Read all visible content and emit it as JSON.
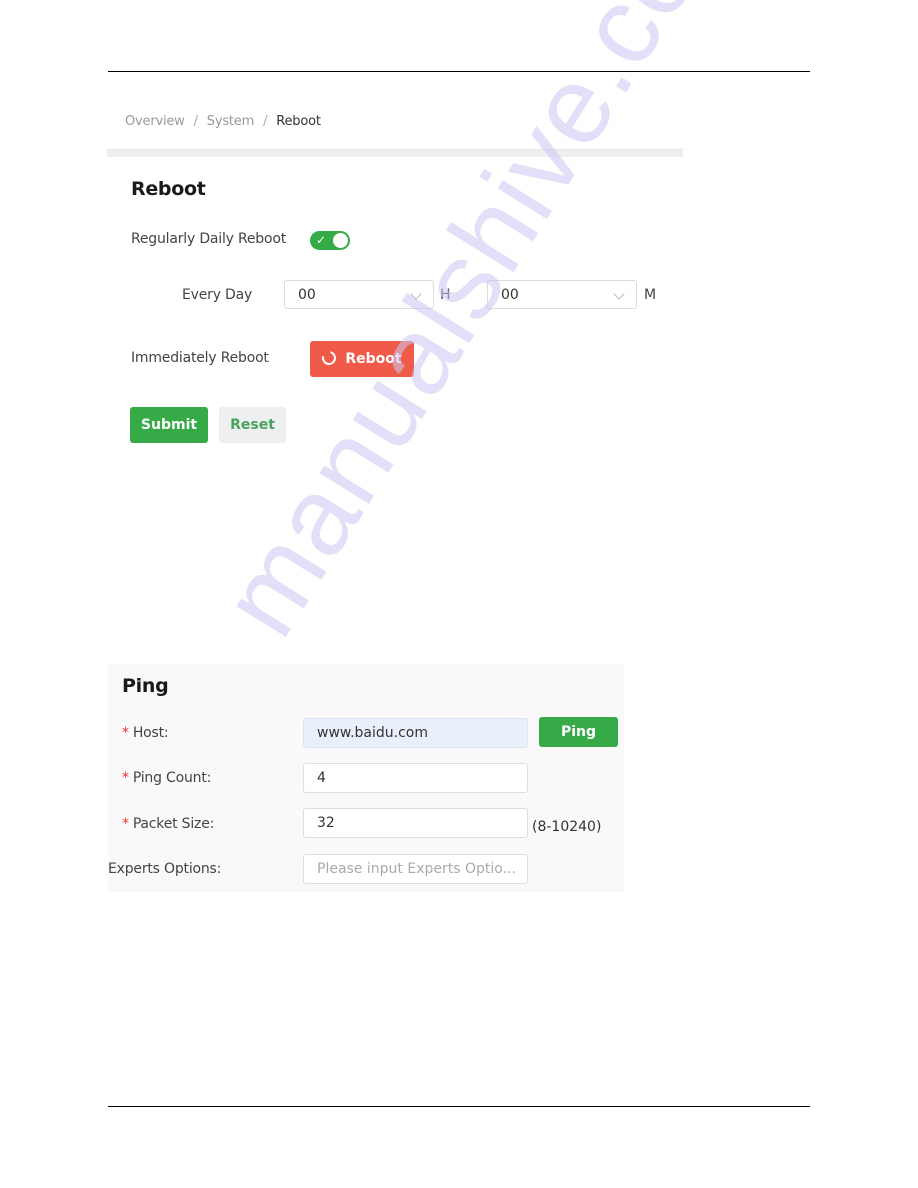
{
  "watermark": "manualshive.com",
  "breadcrumb": {
    "items": [
      "Overview",
      "System",
      "Reboot"
    ],
    "separator": "/"
  },
  "reboot": {
    "title": "Reboot",
    "daily_reboot": {
      "label": "Regularly Daily Reboot",
      "enabled": true,
      "check_glyph": "✓"
    },
    "schedule": {
      "label": "Every Day",
      "hour_value": "00",
      "hour_unit": "H",
      "minute_value": "00",
      "minute_unit": "M"
    },
    "immediate": {
      "label": "Immediately Reboot",
      "button_label": "Reboot",
      "button_icon": "refresh-icon"
    },
    "submit_label": "Submit",
    "reset_label": "Reset"
  },
  "ping": {
    "title": "Ping",
    "required_mark": "*",
    "host": {
      "label": "Host:",
      "value": "www.baidu.com"
    },
    "ping_button_label": "Ping",
    "count": {
      "label": "Ping Count:",
      "value": "4"
    },
    "packet_size": {
      "label": "Packet Size:",
      "value": "32",
      "hint": "(8-10240)"
    },
    "experts": {
      "label": "Experts Options:",
      "placeholder": "Please input Experts Optio..."
    }
  },
  "colors": {
    "primary_green": "#35aa47",
    "danger_red": "#ef5b48",
    "reset_bg": "#eeeff1"
  }
}
